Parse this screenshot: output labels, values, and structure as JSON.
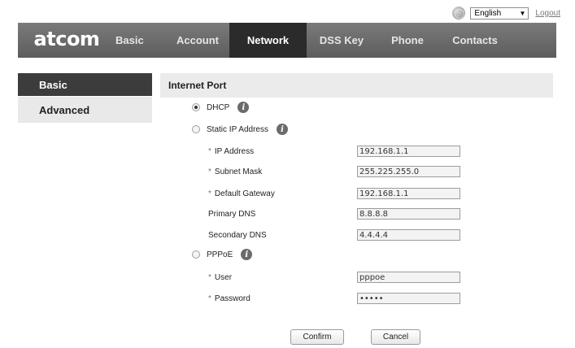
{
  "header": {
    "language": "English",
    "logout": "Logout"
  },
  "nav": {
    "logo": "atcom",
    "items": [
      "Basic",
      "Account",
      "Network",
      "DSS Key",
      "Phone",
      "Contacts"
    ],
    "active": "Network"
  },
  "sidebar": {
    "items": [
      "Basic",
      "Advanced"
    ],
    "active": "Basic"
  },
  "form": {
    "section_title": "Internet Port",
    "dhcp": {
      "label": "DHCP",
      "selected": true
    },
    "static": {
      "label": "Static IP Address",
      "selected": false
    },
    "ip_address": {
      "label": "IP Address",
      "value": "192.168.1.1",
      "required": true
    },
    "subnet_mask": {
      "label": "Subnet Mask",
      "value": "255.225.255.0",
      "required": true
    },
    "default_gateway": {
      "label": "Default Gateway",
      "value": "192.168.1.1",
      "required": true
    },
    "primary_dns": {
      "label": "Primary DNS",
      "value": "8.8.8.8"
    },
    "secondary_dns": {
      "label": "Secondary DNS",
      "value": "4.4.4.4"
    },
    "pppoe": {
      "label": "PPPoE",
      "selected": false
    },
    "user": {
      "label": "User",
      "value": "pppoe",
      "required": true
    },
    "password": {
      "label": "Password",
      "value": "•••••",
      "required": true
    },
    "confirm": "Confirm",
    "cancel": "Cancel",
    "required_marker": "*",
    "info_glyph": "i"
  }
}
